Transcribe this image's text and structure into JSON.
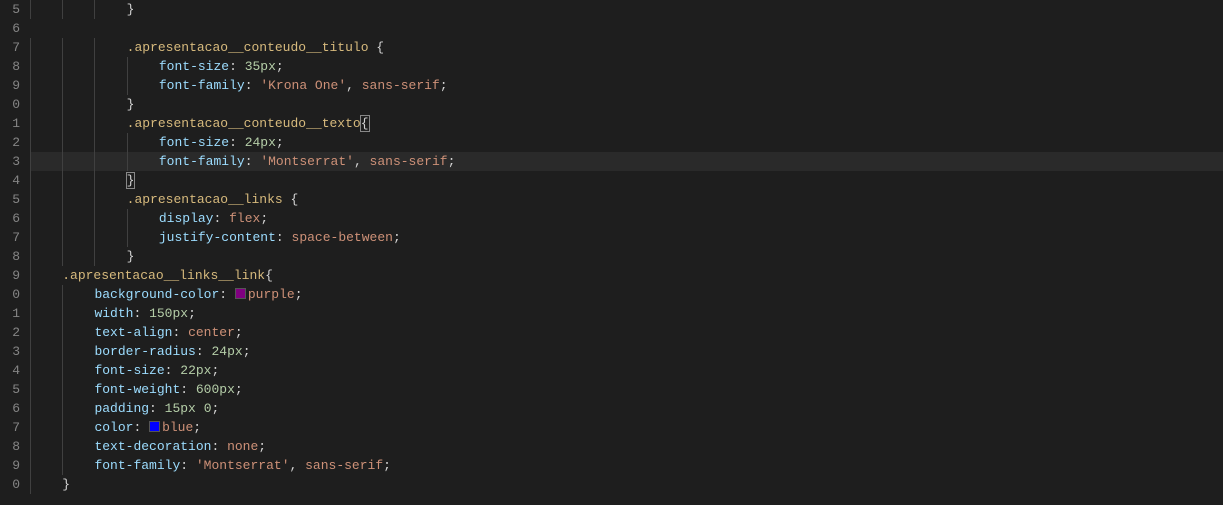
{
  "lines": [
    {
      "num": "5",
      "indent": 3,
      "tokens": [
        {
          "t": "brace",
          "v": "}"
        }
      ]
    },
    {
      "num": "6",
      "indent": 0,
      "tokens": []
    },
    {
      "num": "7",
      "indent": 3,
      "tokens": [
        {
          "t": "selector",
          "v": ".apresentacao__conteudo__titulo "
        },
        {
          "t": "brace",
          "v": "{"
        }
      ]
    },
    {
      "num": "8",
      "indent": 4,
      "tokens": [
        {
          "t": "prop",
          "v": "font-size"
        },
        {
          "t": "punct",
          "v": ": "
        },
        {
          "t": "number",
          "v": "35px"
        },
        {
          "t": "punct",
          "v": ";"
        }
      ]
    },
    {
      "num": "9",
      "indent": 4,
      "tokens": [
        {
          "t": "prop",
          "v": "font-family"
        },
        {
          "t": "punct",
          "v": ": "
        },
        {
          "t": "string",
          "v": "'Krona One'"
        },
        {
          "t": "punct",
          "v": ", "
        },
        {
          "t": "value",
          "v": "sans-serif"
        },
        {
          "t": "punct",
          "v": ";"
        }
      ]
    },
    {
      "num": "0",
      "indent": 3,
      "tokens": [
        {
          "t": "brace",
          "v": "}"
        }
      ]
    },
    {
      "num": "1",
      "indent": 3,
      "tokens": [
        {
          "t": "selector",
          "v": ".apresentacao__conteudo__texto"
        },
        {
          "t": "brace",
          "v": "{",
          "box": true
        }
      ]
    },
    {
      "num": "2",
      "indent": 4,
      "tokens": [
        {
          "t": "prop",
          "v": "font-size"
        },
        {
          "t": "punct",
          "v": ": "
        },
        {
          "t": "number",
          "v": "24px"
        },
        {
          "t": "punct",
          "v": ";"
        }
      ]
    },
    {
      "num": "3",
      "indent": 4,
      "highlight": true,
      "tokens": [
        {
          "t": "prop",
          "v": "font-family"
        },
        {
          "t": "punct",
          "v": ": "
        },
        {
          "t": "string",
          "v": "'Montserrat'"
        },
        {
          "t": "punct",
          "v": ", "
        },
        {
          "t": "value",
          "v": "sans-serif"
        },
        {
          "t": "punct",
          "v": ";"
        }
      ]
    },
    {
      "num": "4",
      "indent": 3,
      "tokens": [
        {
          "t": "brace",
          "v": "}",
          "box": true
        }
      ]
    },
    {
      "num": "5",
      "indent": 3,
      "tokens": [
        {
          "t": "selector",
          "v": ".apresentacao__links "
        },
        {
          "t": "brace",
          "v": "{"
        }
      ]
    },
    {
      "num": "6",
      "indent": 4,
      "tokens": [
        {
          "t": "prop",
          "v": "display"
        },
        {
          "t": "punct",
          "v": ": "
        },
        {
          "t": "value",
          "v": "flex"
        },
        {
          "t": "punct",
          "v": ";"
        }
      ]
    },
    {
      "num": "7",
      "indent": 4,
      "tokens": [
        {
          "t": "prop",
          "v": "justify-content"
        },
        {
          "t": "punct",
          "v": ": "
        },
        {
          "t": "value",
          "v": "space-between"
        },
        {
          "t": "punct",
          "v": ";"
        }
      ]
    },
    {
      "num": "8",
      "indent": 3,
      "tokens": [
        {
          "t": "brace",
          "v": "}"
        }
      ]
    },
    {
      "num": "9",
      "indent": 1,
      "tokens": [
        {
          "t": "selector",
          "v": ".apresentacao__links__link"
        },
        {
          "t": "brace",
          "v": "{"
        }
      ]
    },
    {
      "num": "0",
      "indent": 2,
      "tokens": [
        {
          "t": "prop",
          "v": "background-color"
        },
        {
          "t": "punct",
          "v": ": "
        },
        {
          "t": "swatch",
          "v": "#800080"
        },
        {
          "t": "value",
          "v": "purple"
        },
        {
          "t": "punct",
          "v": ";"
        }
      ]
    },
    {
      "num": "1",
      "indent": 2,
      "tokens": [
        {
          "t": "prop",
          "v": "width"
        },
        {
          "t": "punct",
          "v": ": "
        },
        {
          "t": "number",
          "v": "150px"
        },
        {
          "t": "punct",
          "v": ";"
        }
      ]
    },
    {
      "num": "2",
      "indent": 2,
      "tokens": [
        {
          "t": "prop",
          "v": "text-align"
        },
        {
          "t": "punct",
          "v": ": "
        },
        {
          "t": "value",
          "v": "center"
        },
        {
          "t": "punct",
          "v": ";"
        }
      ]
    },
    {
      "num": "3",
      "indent": 2,
      "tokens": [
        {
          "t": "prop",
          "v": "border-radius"
        },
        {
          "t": "punct",
          "v": ": "
        },
        {
          "t": "number",
          "v": "24px"
        },
        {
          "t": "punct",
          "v": ";"
        }
      ]
    },
    {
      "num": "4",
      "indent": 2,
      "tokens": [
        {
          "t": "prop",
          "v": "font-size"
        },
        {
          "t": "punct",
          "v": ": "
        },
        {
          "t": "number",
          "v": "22px"
        },
        {
          "t": "punct",
          "v": ";"
        }
      ]
    },
    {
      "num": "5",
      "indent": 2,
      "tokens": [
        {
          "t": "prop",
          "v": "font-weight"
        },
        {
          "t": "punct",
          "v": ": "
        },
        {
          "t": "number",
          "v": "600px"
        },
        {
          "t": "punct",
          "v": ";"
        }
      ]
    },
    {
      "num": "6",
      "indent": 2,
      "tokens": [
        {
          "t": "prop",
          "v": "padding"
        },
        {
          "t": "punct",
          "v": ": "
        },
        {
          "t": "number",
          "v": "15px"
        },
        {
          "t": "punct",
          "v": " "
        },
        {
          "t": "number",
          "v": "0"
        },
        {
          "t": "punct",
          "v": ";"
        }
      ]
    },
    {
      "num": "7",
      "indent": 2,
      "tokens": [
        {
          "t": "prop",
          "v": "color"
        },
        {
          "t": "punct",
          "v": ": "
        },
        {
          "t": "swatch",
          "v": "#0000ff"
        },
        {
          "t": "value",
          "v": "blue"
        },
        {
          "t": "punct",
          "v": ";"
        }
      ]
    },
    {
      "num": "8",
      "indent": 2,
      "tokens": [
        {
          "t": "prop",
          "v": "text-decoration"
        },
        {
          "t": "punct",
          "v": ": "
        },
        {
          "t": "value",
          "v": "none"
        },
        {
          "t": "punct",
          "v": ";"
        }
      ]
    },
    {
      "num": "9",
      "indent": 2,
      "tokens": [
        {
          "t": "prop",
          "v": "font-family"
        },
        {
          "t": "punct",
          "v": ": "
        },
        {
          "t": "string",
          "v": "'Montserrat'"
        },
        {
          "t": "punct",
          "v": ", "
        },
        {
          "t": "value",
          "v": "sans-serif"
        },
        {
          "t": "punct",
          "v": ";"
        }
      ]
    },
    {
      "num": "0",
      "indent": 1,
      "tokens": [
        {
          "t": "brace",
          "v": "}"
        }
      ]
    }
  ]
}
